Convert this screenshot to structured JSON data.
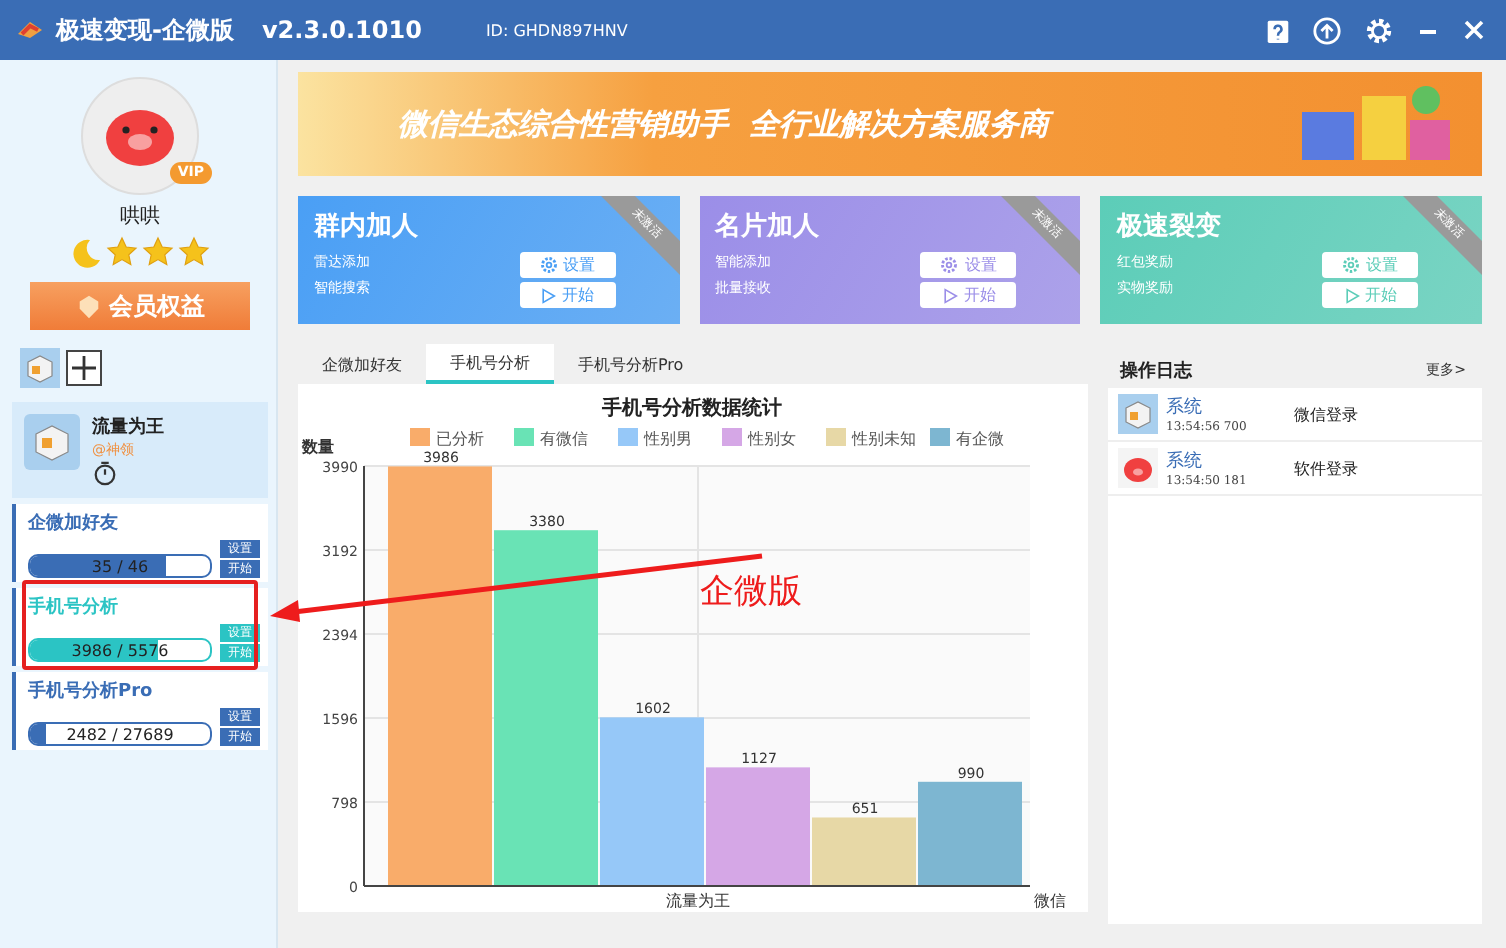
{
  "window": {
    "title": "极速变现-企微版",
    "version": "v2.3.0.1010",
    "id": "ID: GHDN897HNV"
  },
  "profile": {
    "name": "哄哄",
    "badge": "VIP",
    "stars": 3,
    "member_button": "会员权益"
  },
  "account": {
    "name": "流量为王",
    "tag": "@神领"
  },
  "tasks": [
    {
      "name": "企微加好友",
      "progress": "35 / 46",
      "level": 0.76,
      "selected": false,
      "settings": "设置",
      "start": "开始"
    },
    {
      "name": "手机号分析",
      "progress": "3986 / 5576",
      "level": 0.71,
      "selected": true,
      "settings": "设置",
      "start": "开始"
    },
    {
      "name": "手机号分析Pro",
      "progress": "2482 / 27689",
      "level": 0.09,
      "selected": false,
      "settings": "设置",
      "start": "开始"
    }
  ],
  "banner": {
    "text": "微信生态综合性营销助手  全行业解决方案服务商"
  },
  "cards": [
    {
      "title": "群内加人",
      "lines": [
        "雷达添加",
        "智能搜索"
      ],
      "ribbon": "未激活",
      "color": "#4a9ff5",
      "settings": "设置",
      "start": "开始"
    },
    {
      "title": "名片加人",
      "lines": [
        "智能添加",
        "批量接收"
      ],
      "ribbon": "未激活",
      "color": "#9b8ee8",
      "settings": "设置",
      "start": "开始"
    },
    {
      "title": "极速裂变",
      "lines": [
        "红包奖励",
        "实物奖励"
      ],
      "ribbon": "未激活",
      "color": "#5ccdb8",
      "settings": "设置",
      "start": "开始"
    }
  ],
  "tabs": [
    {
      "label": "企微加好友",
      "selected": false
    },
    {
      "label": "手机号分析",
      "selected": true
    },
    {
      "label": "手机号分析Pro",
      "selected": false
    }
  ],
  "chart_data": {
    "type": "bar",
    "title": "手机号分析数据统计",
    "xlabel": "微信",
    "ylabel": "数量",
    "categories": [
      "流量为王"
    ],
    "series": [
      {
        "name": "已分析",
        "color": "#f9ac6a",
        "values": [
          3986
        ]
      },
      {
        "name": "有微信",
        "color": "#69e3b5",
        "values": [
          3380
        ]
      },
      {
        "name": "性别男",
        "color": "#96c8f8",
        "values": [
          1602
        ]
      },
      {
        "name": "性别女",
        "color": "#d5a7e6",
        "values": [
          1127
        ]
      },
      {
        "name": "性别未知",
        "color": "#e7d8a6",
        "values": [
          651
        ]
      },
      {
        "name": "有企微",
        "color": "#7db6d1",
        "values": [
          990
        ]
      }
    ],
    "ylim": [
      0,
      3990
    ],
    "grid": true,
    "legend": "top",
    "yticks": [
      0,
      798,
      1596,
      2394,
      3192,
      3990
    ],
    "data_labels": true
  },
  "log": {
    "title": "操作日志",
    "more": "更多>",
    "entries": [
      {
        "user": "系统",
        "time": "13:54:56 700",
        "action": "微信登录",
        "kind": "app"
      },
      {
        "user": "系统",
        "time": "13:54:50 181",
        "action": "软件登录",
        "kind": "pig"
      }
    ]
  },
  "annotation": {
    "label": "企微版"
  }
}
